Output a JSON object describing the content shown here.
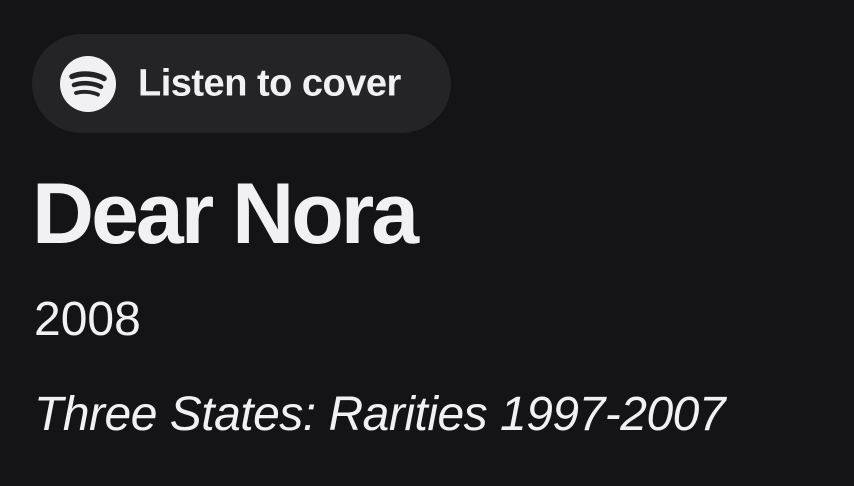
{
  "listen_button": {
    "label": "Listen to cover",
    "icon": "spotify-icon"
  },
  "song": {
    "title": "Dear Nora",
    "year": "2008",
    "album": "Three States: Rarities 1997-2007"
  },
  "colors": {
    "background": "#141416",
    "pill": "#242426",
    "text": "#f1f1f3"
  }
}
